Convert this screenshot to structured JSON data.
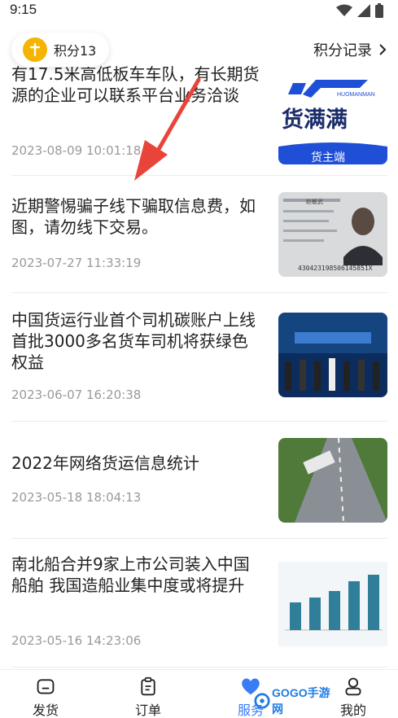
{
  "status": {
    "time": "9:15"
  },
  "points": {
    "label": "积分13",
    "record_label": "积分记录"
  },
  "news": [
    {
      "title": "有17.5米高低板车车队，有长期货源的企业可以联系平台业务洽谈",
      "date": "2023-08-09 10:01:18",
      "thumb": {
        "brand_en": "HUOMANMAN",
        "brand_cn": "货满满",
        "sub": "货主端"
      }
    },
    {
      "title": "近期警惕骗子线下骗取信息费，如图，请勿线下交易。",
      "date": "2023-07-27 11:33:19",
      "thumb": {
        "name": "赵敏武",
        "id": "430423198506145851X"
      }
    },
    {
      "title": "中国货运行业首个司机碳账户上线 首批3000多名货车司机将获绿色权益",
      "date": "2023-06-07 16:20:38",
      "thumb": {}
    },
    {
      "title": "2022年网络货运信息统计",
      "date": "2023-05-18 18:04:13",
      "thumb": {}
    },
    {
      "title": "南北船合并9家上市公司装入中国船舶 我国造船业集中度或将提升",
      "date": "2023-05-16 14:23:06",
      "thumb": {}
    }
  ],
  "nav": [
    {
      "label": "发货",
      "icon": "shipping-icon"
    },
    {
      "label": "订单",
      "icon": "order-clipboard-icon"
    },
    {
      "label": "服务",
      "icon": "service-heart-icon",
      "active": true
    },
    {
      "label": "我的",
      "icon": "profile-icon"
    }
  ],
  "watermark": {
    "text": "GOGO手游网"
  },
  "colors": {
    "accent": "#3a7cf5",
    "coin": "#f5b400",
    "annotation": "#e8443a"
  }
}
